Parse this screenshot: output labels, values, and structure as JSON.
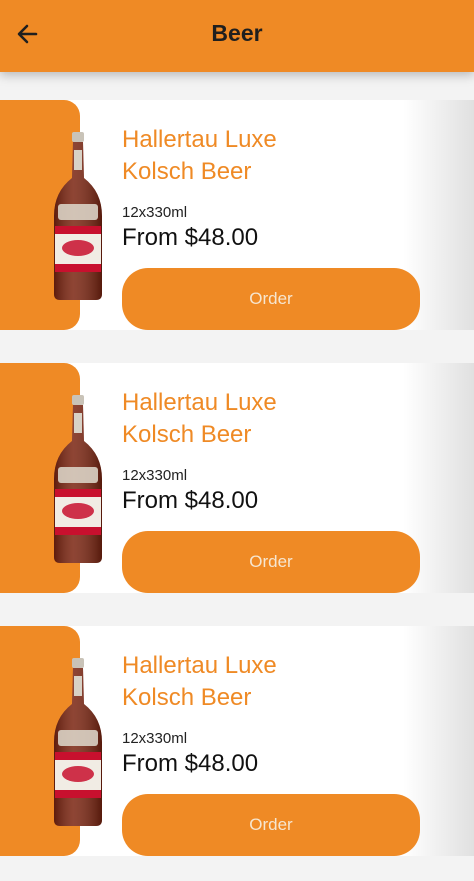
{
  "header": {
    "title": "Beer",
    "back_icon": "arrow-left-icon"
  },
  "colors": {
    "accent": "#ef8a25",
    "background": "#f3f3f3"
  },
  "products": [
    {
      "name_line1": "Hallertau Luxe",
      "name_line2": "Kolsch Beer",
      "size": "12x330ml",
      "price": "From $48.00",
      "order_label": "Order"
    },
    {
      "name_line1": "Hallertau Luxe",
      "name_line2": "Kolsch Beer",
      "size": "12x330ml",
      "price": "From $48.00",
      "order_label": "Order"
    },
    {
      "name_line1": "Hallertau Luxe",
      "name_line2": "Kolsch Beer",
      "size": "12x330ml",
      "price": "From $48.00",
      "order_label": "Order"
    }
  ]
}
